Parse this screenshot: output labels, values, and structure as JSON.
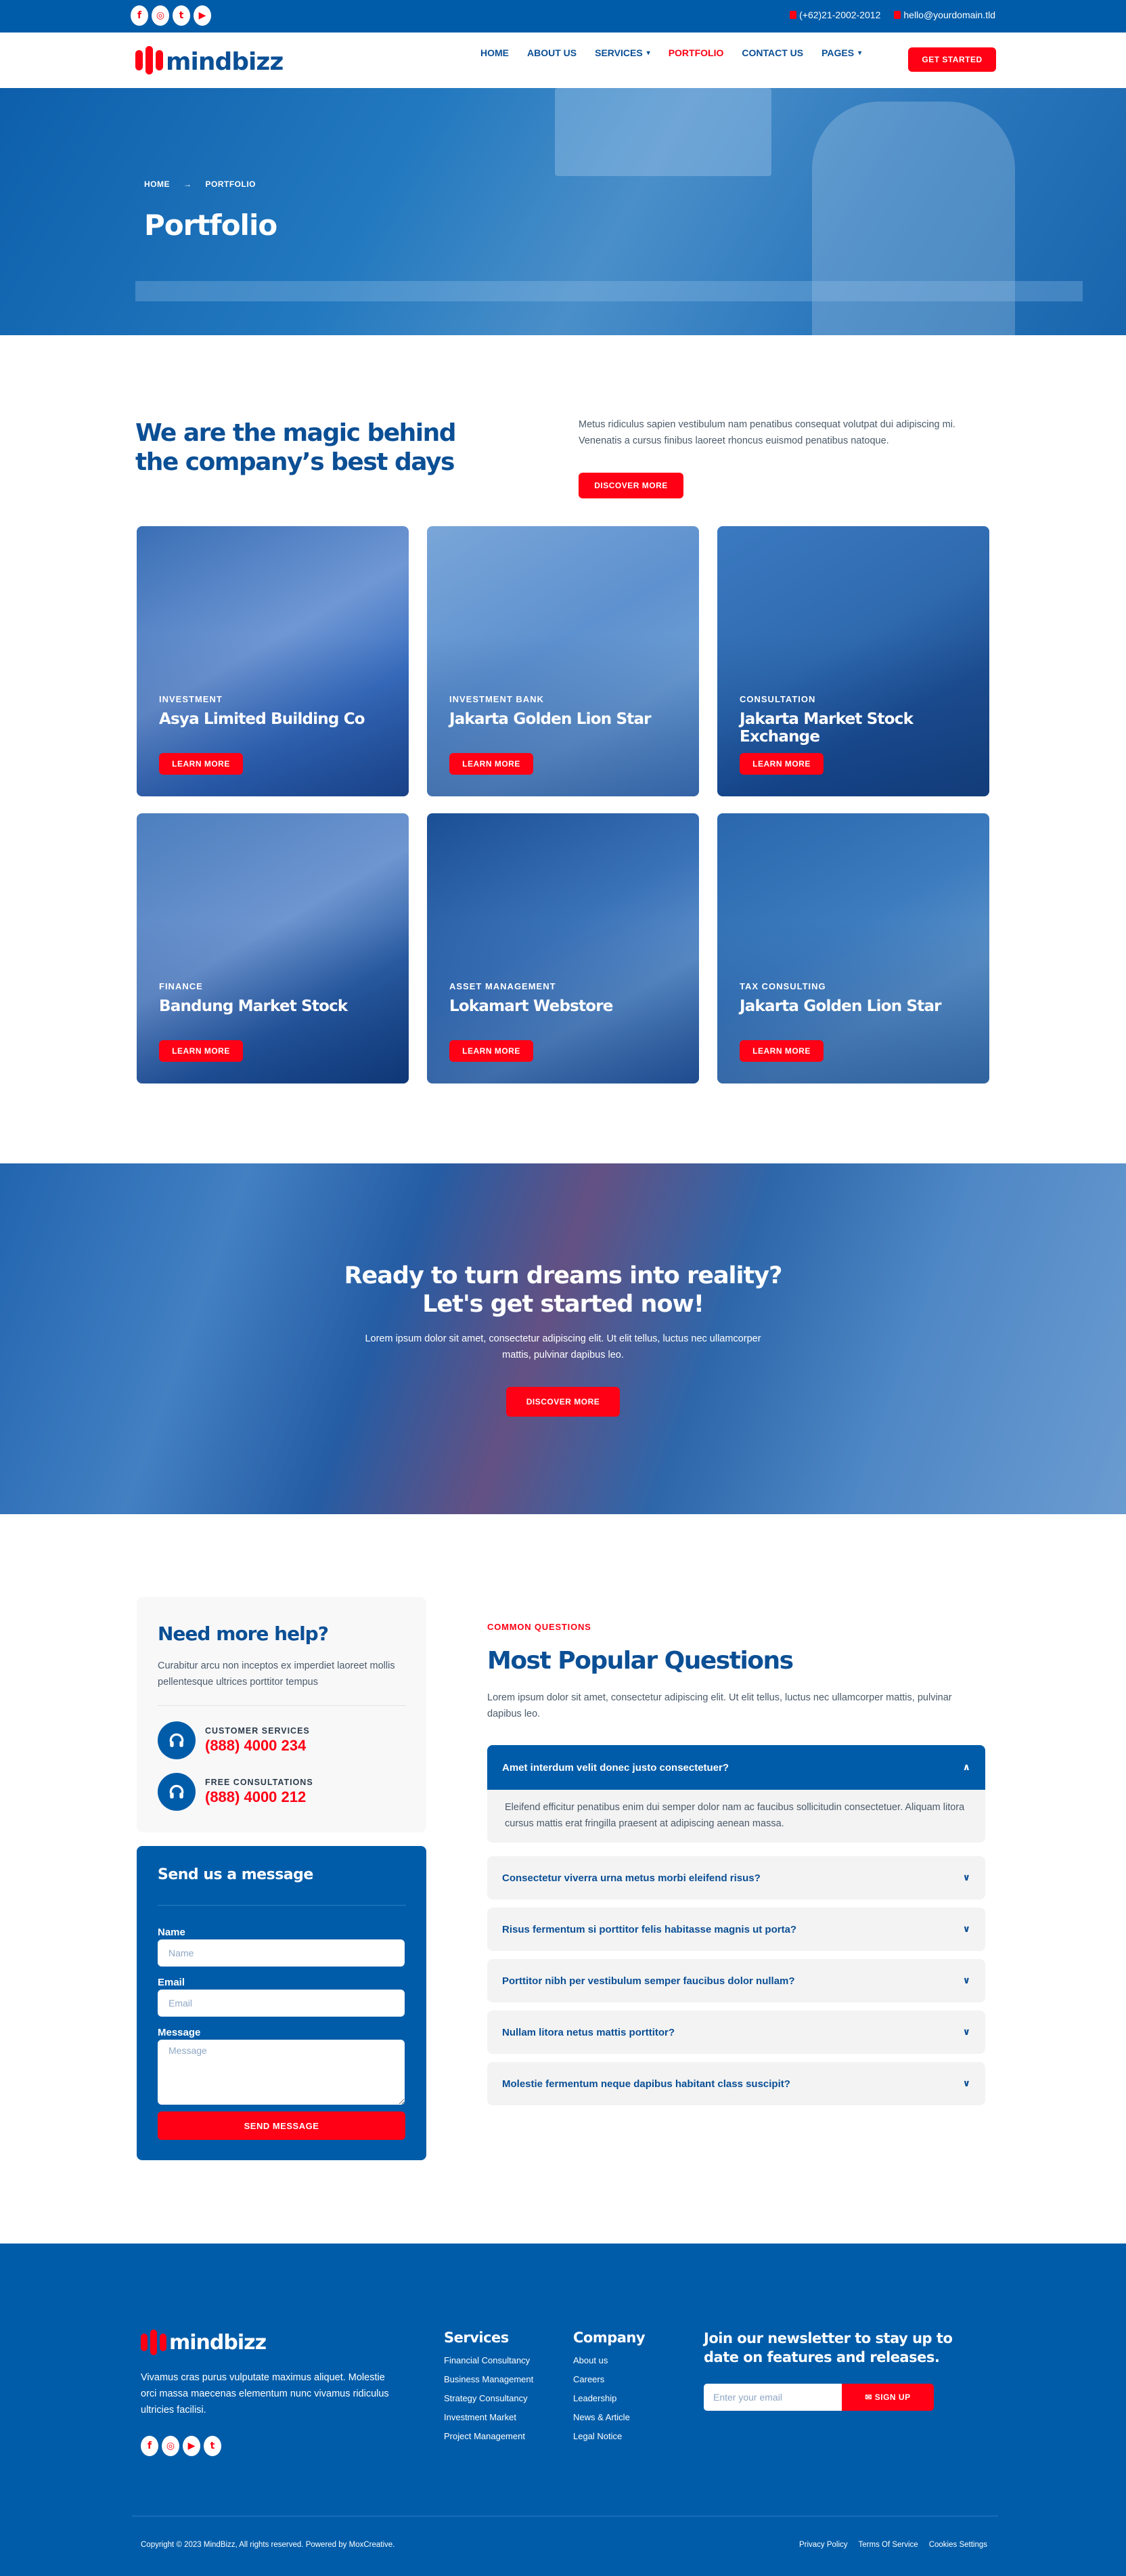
{
  "topbar": {
    "socials": [
      {
        "icon": "facebook-icon",
        "glyph": "f"
      },
      {
        "icon": "instagram-icon",
        "glyph": "◎"
      },
      {
        "icon": "twitter-icon",
        "glyph": "t"
      },
      {
        "icon": "youtube-icon",
        "glyph": "▶"
      }
    ],
    "phone": "(+62)21-2002-2012",
    "email": "hello@yourdomain.tld"
  },
  "brand": {
    "name": "mindbizz",
    "primary": "#005ca9",
    "accent": "#ff0014"
  },
  "nav": {
    "items": [
      {
        "label": "HOME",
        "dropdown": false,
        "active": false
      },
      {
        "label": "ABOUT US",
        "dropdown": false,
        "active": false
      },
      {
        "label": "SERVICES",
        "dropdown": true,
        "active": false
      },
      {
        "label": "PORTFOLIO",
        "dropdown": false,
        "active": true
      },
      {
        "label": "CONTACT US",
        "dropdown": false,
        "active": false
      },
      {
        "label": "PAGES",
        "dropdown": true,
        "active": false
      }
    ],
    "cta": "GET STARTED"
  },
  "hero": {
    "breadcrumb": [
      "HOME",
      "PORTFOLIO"
    ],
    "title": "Portfolio"
  },
  "intro": {
    "heading": "We are the magic behind the company’s best days",
    "text": "Metus ridiculus sapien vestibulum nam penatibus consequat volutpat dui adipiscing mi. Venenatis a cursus finibus laoreet rhoncus euismod penatibus natoque.",
    "button": "DISCOVER MORE"
  },
  "portfolio": [
    {
      "category": "INVESTMENT",
      "title": "Asya Limited Building Co",
      "button": "LEARN MORE"
    },
    {
      "category": "INVESTMENT BANK",
      "title": "Jakarta Golden Lion Star",
      "button": "LEARN MORE"
    },
    {
      "category": "CONSULTATION",
      "title": "Jakarta Market Stock Exchange",
      "button": "LEARN MORE"
    },
    {
      "category": "FINANCE",
      "title": "Bandung Market Stock",
      "button": "LEARN MORE"
    },
    {
      "category": "ASSET MANAGEMENT",
      "title": "Lokamart Webstore",
      "button": "LEARN MORE"
    },
    {
      "category": "TAX CONSULTING",
      "title": "Jakarta Golden Lion Star",
      "button": "LEARN MORE"
    }
  ],
  "cta": {
    "line1": "Ready to turn dreams into reality?",
    "line2": "Let's get started now!",
    "text": "Lorem ipsum dolor sit amet, consectetur adipiscing elit. Ut elit tellus, luctus nec ullamcorper mattis, pulvinar dapibus leo.",
    "button": "DISCOVER MORE"
  },
  "help": {
    "title": "Need more help?",
    "text": "Curabitur arcu non inceptos ex imperdiet laoreet mollis pellentesque ultrices porttitor tempus",
    "contacts": [
      {
        "label": "CUSTOMER SERVICES",
        "number": "(888) 4000 234",
        "icon": "headphones-icon"
      },
      {
        "label": "FREE CONSULTATIONS",
        "number": "(888) 4000 212",
        "icon": "headphones-icon"
      }
    ]
  },
  "form": {
    "title": "Send us a message",
    "name_label": "Name",
    "name_placeholder": "Name",
    "email_label": "Email",
    "email_placeholder": "Email",
    "message_label": "Message",
    "message_placeholder": "Message",
    "button": "SEND MESSAGE"
  },
  "faq": {
    "eyebrow": "COMMON QUESTIONS",
    "title": "Most Popular Questions",
    "text": "Lorem ipsum dolor sit amet, consectetur adipiscing elit. Ut elit tellus, luctus nec ullamcorper mattis, pulvinar dapibus leo.",
    "items": [
      {
        "q": "Amet interdum velit donec justo consectetuer?",
        "a": "Eleifend efficitur penatibus enim dui semper dolor nam ac faucibus sollicitudin consectetuer. Aliquam litora cursus mattis erat fringilla praesent at adipiscing aenean massa.",
        "open": true
      },
      {
        "q": "Consectetur viverra urna metus morbi eleifend risus?",
        "open": false
      },
      {
        "q": "Risus fermentum si porttitor felis habitasse magnis ut porta?",
        "open": false
      },
      {
        "q": "Porttitor nibh per vestibulum semper faucibus dolor nullam?",
        "open": false
      },
      {
        "q": "Nullam litora netus mattis porttitor?",
        "open": false
      },
      {
        "q": "Molestie fermentum neque dapibus habitant class suscipit?",
        "open": false
      }
    ]
  },
  "footer": {
    "brand": "mindbizz",
    "description": "Vivamus cras purus vulputate maximus aliquet. Molestie orci massa maecenas elementum nunc vivamus ridiculus ultricies facilisi.",
    "socials": [
      {
        "icon": "facebook-icon",
        "glyph": "f"
      },
      {
        "icon": "instagram-icon",
        "glyph": "◎"
      },
      {
        "icon": "youtube-icon",
        "glyph": "▶"
      },
      {
        "icon": "twitter-icon",
        "glyph": "t"
      }
    ],
    "services_title": "Services",
    "services": [
      "Financial Consultancy",
      "Business Management",
      "Strategy Consultancy",
      "Investment Market",
      "Project Management"
    ],
    "company_title": "Company",
    "company": [
      "About us",
      "Careers",
      "Leadership",
      "News & Article",
      "Legal Notice"
    ],
    "newsletter_title": "Join our newsletter to stay up to date on features and releases.",
    "newsletter_placeholder": "Enter your email",
    "newsletter_button": "✉ SIGN UP",
    "copyright": "Copyright © 2023 MindBizz, All rights reserved. Powered by MoxCreative.",
    "legal": [
      "Privacy Policy",
      "Terms Of Service",
      "Cookies Settings"
    ]
  }
}
